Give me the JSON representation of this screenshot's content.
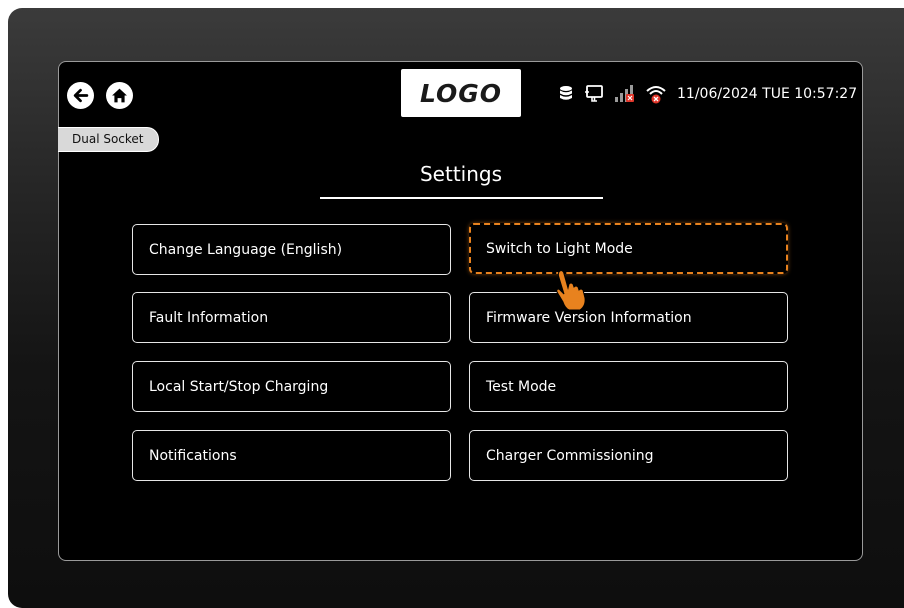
{
  "header": {
    "logo_text": "LOGO",
    "datetime": "11/06/2024 TUE 10:57:27",
    "status_icons": [
      "database-icon",
      "network-monitor-icon",
      "signal-bars-error-icon",
      "wifi-error-icon"
    ]
  },
  "socket_tab": {
    "label": "Dual Socket"
  },
  "page": {
    "title": "Settings"
  },
  "menu": {
    "items": [
      {
        "label": "Change Language (English)"
      },
      {
        "label": "Switch to Light Mode",
        "highlighted": true
      },
      {
        "label": "Fault Information"
      },
      {
        "label": "Firmware Version Information"
      },
      {
        "label": "Local Start/Stop Charging"
      },
      {
        "label": "Test Mode"
      },
      {
        "label": "Notifications"
      },
      {
        "label": "Charger Commissioning"
      }
    ]
  },
  "colors": {
    "highlight": "#e8821e",
    "background": "#000000",
    "error": "#e0362a"
  }
}
